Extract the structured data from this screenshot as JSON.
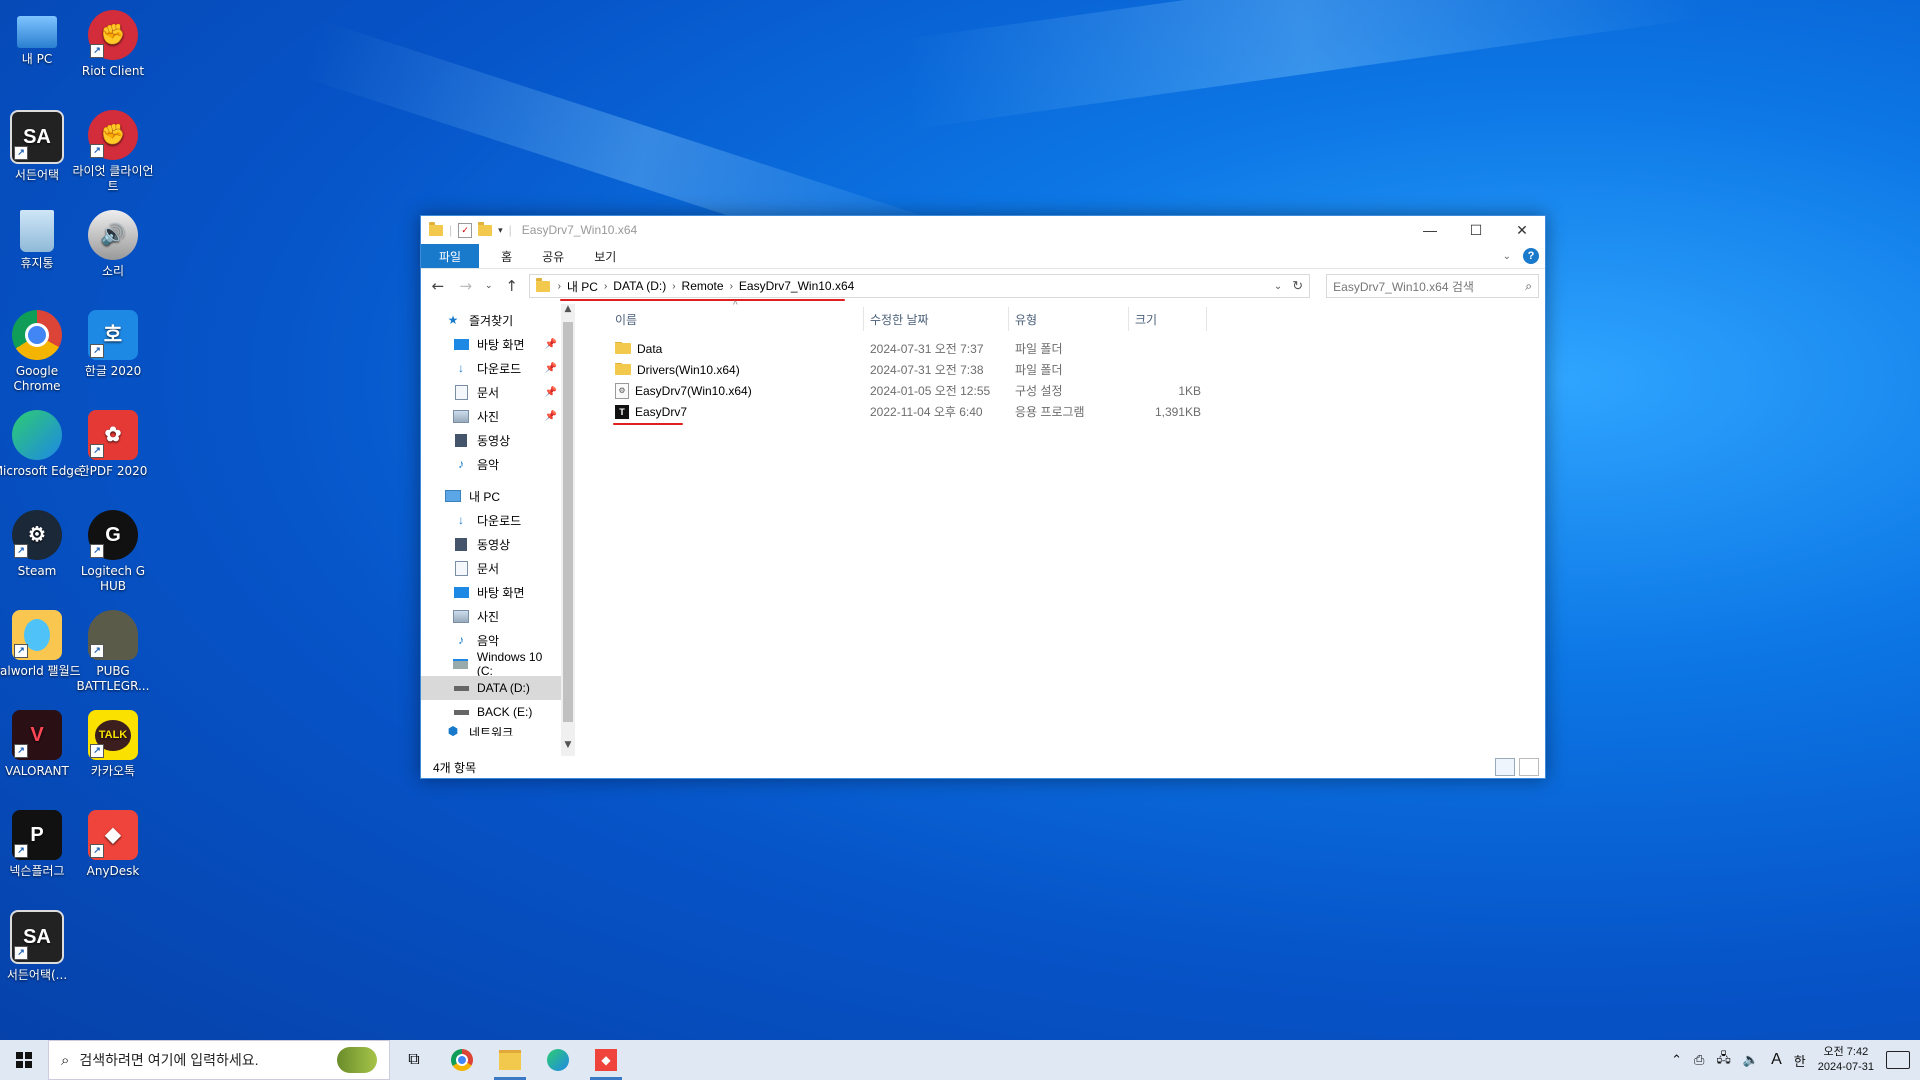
{
  "desktop": {
    "icons": [
      {
        "label": "내 PC"
      },
      {
        "label": "Riot Client"
      },
      {
        "label": "서든어택"
      },
      {
        "label": "라이엇 클라이언트"
      },
      {
        "label": "휴지통"
      },
      {
        "label": "소리"
      },
      {
        "label": "Google Chrome"
      },
      {
        "label": "한글 2020"
      },
      {
        "label": "Microsoft Edge"
      },
      {
        "label": "한PDF 2020"
      },
      {
        "label": "Steam"
      },
      {
        "label": "Logitech G HUB"
      },
      {
        "label": "Palworld 팰월드"
      },
      {
        "label": "PUBG BATTLEGR..."
      },
      {
        "label": "VALORANT"
      },
      {
        "label": "카카오톡"
      },
      {
        "label": "넥슨플러그"
      },
      {
        "label": "AnyDesk"
      },
      {
        "label": "서든어택(..."
      }
    ]
  },
  "window": {
    "title": "EasyDrv7_Win10.x64",
    "ribbon_tabs": [
      "파일",
      "홈",
      "공유",
      "보기"
    ],
    "help": "?",
    "breadcrumb": [
      "내 PC",
      "DATA (D:)",
      "Remote",
      "EasyDrv7_Win10.x64"
    ],
    "search_placeholder": "EasyDrv7_Win10.x64 검색",
    "nav": {
      "quick_access": "즐겨찾기",
      "quick_items": [
        "바탕 화면",
        "다운로드",
        "문서",
        "사진",
        "동영상",
        "음악"
      ],
      "this_pc": "내 PC",
      "pc_items": [
        "다운로드",
        "동영상",
        "문서",
        "바탕 화면",
        "사진",
        "음악",
        "Windows 10 (C:",
        "DATA (D:)",
        "BACK (E:)"
      ],
      "cut_item": "네트워크"
    },
    "columns": {
      "name": "이름",
      "date": "수정한 날짜",
      "type": "유형",
      "size": "크기"
    },
    "files": [
      {
        "name": "Data",
        "date": "2024-07-31 오전 7:37",
        "type": "파일 폴더",
        "size": "",
        "icon": "folder-icon"
      },
      {
        "name": "Drivers(Win10.x64)",
        "date": "2024-07-31 오전 7:38",
        "type": "파일 폴더",
        "size": "",
        "icon": "folder-icon"
      },
      {
        "name": "EasyDrv7(Win10.x64)",
        "date": "2024-01-05 오전 12:55",
        "type": "구성 설정",
        "size": "1KB",
        "icon": "config-file-icon"
      },
      {
        "name": "EasyDrv7",
        "date": "2022-11-04 오후 6:40",
        "type": "응용 프로그램",
        "size": "1,391KB",
        "icon": "app-icon"
      }
    ],
    "status": "4개 항목"
  },
  "taskbar": {
    "search_placeholder": "검색하려면 여기에 입력하세요.",
    "ime_mode": "A",
    "ime_lang": "한",
    "time": "오전 7:42",
    "date": "2024-07-31"
  },
  "colors": {
    "accent": "#1979ca",
    "annotation": "#e02020"
  }
}
